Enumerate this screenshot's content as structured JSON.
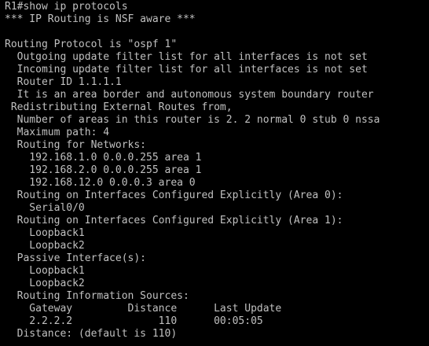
{
  "terminal": {
    "colors": {
      "background": "#000000",
      "foreground": "#c0c0c0"
    },
    "lines": [
      "R1#show ip protocols",
      "*** IP Routing is NSF aware ***",
      "",
      "Routing Protocol is \"ospf 1\"",
      "  Outgoing update filter list for all interfaces is not set",
      "  Incoming update filter list for all interfaces is not set",
      "  Router ID 1.1.1.1",
      "  It is an area border and autonomous system boundary router",
      " Redistributing External Routes from,",
      "  Number of areas in this router is 2. 2 normal 0 stub 0 nssa",
      "  Maximum path: 4",
      "  Routing for Networks:",
      "    192.168.1.0 0.0.0.255 area 1",
      "    192.168.2.0 0.0.0.255 area 1",
      "    192.168.12.0 0.0.0.3 area 0",
      "  Routing on Interfaces Configured Explicitly (Area 0):",
      "    Serial0/0",
      "  Routing on Interfaces Configured Explicitly (Area 1):",
      "    Loopback1",
      "    Loopback2",
      "  Passive Interface(s):",
      "    Loopback1",
      "    Loopback2",
      "  Routing Information Sources:",
      "    Gateway         Distance      Last Update",
      "    2.2.2.2              110      00:05:05",
      "  Distance: (default is 110)"
    ]
  }
}
